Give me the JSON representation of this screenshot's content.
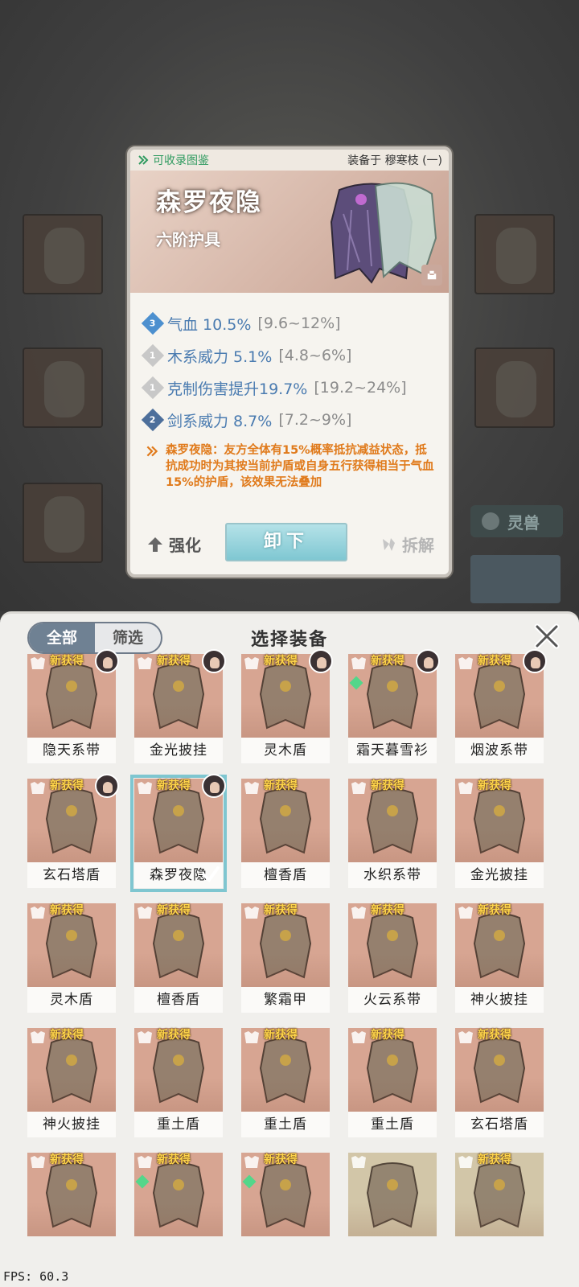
{
  "background": {
    "pet_label": "灵兽"
  },
  "detail": {
    "collectable": "可收录图鉴",
    "equipped_by": "装备于 穆寒枝 (一)",
    "name": "森罗夜隐",
    "grade": "六阶护具",
    "stats": [
      {
        "level": "3",
        "label": "气血 10.5%",
        "range": "[9.6~12%]",
        "badge": "blue"
      },
      {
        "level": "1",
        "label": "木系威力 5.1%",
        "range": "[4.8~6%]",
        "badge": "grey"
      },
      {
        "level": "1",
        "label": "克制伤害提升19.7%",
        "range": "[19.2~24%]",
        "badge": "grey"
      },
      {
        "level": "2",
        "label": "剑系威力 8.7%",
        "range": "[7.2~9%]",
        "badge": "dark"
      }
    ],
    "special": "森罗夜隐：友方全体有15%概率抵抗减益状态，抵抗成功时为其按当前护盾或自身五行获得相当于气血15%的护盾，该效果无法叠加",
    "actions": {
      "strengthen": "强化",
      "unequip": "卸下",
      "dismantle": "拆解"
    }
  },
  "panel": {
    "title": "选择装备",
    "tabs": {
      "all": "全部",
      "filter": "筛选"
    },
    "new_tag": "新获得",
    "items": [
      {
        "name": "隐天系带",
        "color": "#d7a592",
        "new": true,
        "portrait": true,
        "gem": false,
        "selected": false
      },
      {
        "name": "金光披挂",
        "color": "#d7a592",
        "new": true,
        "portrait": true,
        "gem": false,
        "selected": false
      },
      {
        "name": "灵木盾",
        "color": "#d7a592",
        "new": true,
        "portrait": true,
        "gem": false,
        "selected": false
      },
      {
        "name": "霜天暮雪衫",
        "color": "#d7a592",
        "new": true,
        "portrait": true,
        "gem": true,
        "selected": false
      },
      {
        "name": "烟波系带",
        "color": "#d7a592",
        "new": true,
        "portrait": true,
        "gem": false,
        "selected": false
      },
      {
        "name": "玄石塔盾",
        "color": "#d7a592",
        "new": true,
        "portrait": true,
        "gem": false,
        "selected": false
      },
      {
        "name": "森罗夜隐",
        "color": "#d7a592",
        "new": true,
        "portrait": true,
        "gem": false,
        "selected": true
      },
      {
        "name": "檀香盾",
        "color": "#d7a592",
        "new": true,
        "portrait": false,
        "gem": false,
        "selected": false
      },
      {
        "name": "水织系带",
        "color": "#d7a592",
        "new": true,
        "portrait": false,
        "gem": false,
        "selected": false
      },
      {
        "name": "金光披挂",
        "color": "#d7a592",
        "new": true,
        "portrait": false,
        "gem": false,
        "selected": false
      },
      {
        "name": "灵木盾",
        "color": "#d7a592",
        "new": true,
        "portrait": false,
        "gem": false,
        "selected": false
      },
      {
        "name": "檀香盾",
        "color": "#d7a592",
        "new": true,
        "portrait": false,
        "gem": false,
        "selected": false
      },
      {
        "name": "繁霜甲",
        "color": "#d7a592",
        "new": true,
        "portrait": false,
        "gem": false,
        "selected": false
      },
      {
        "name": "火云系带",
        "color": "#d7a592",
        "new": true,
        "portrait": false,
        "gem": false,
        "selected": false
      },
      {
        "name": "神火披挂",
        "color": "#d7a592",
        "new": true,
        "portrait": false,
        "gem": false,
        "selected": false
      },
      {
        "name": "神火披挂",
        "color": "#d7a592",
        "new": true,
        "portrait": false,
        "gem": false,
        "selected": false
      },
      {
        "name": "重土盾",
        "color": "#d7a592",
        "new": true,
        "portrait": false,
        "gem": false,
        "selected": false
      },
      {
        "name": "重土盾",
        "color": "#d7a592",
        "new": true,
        "portrait": false,
        "gem": false,
        "selected": false
      },
      {
        "name": "重土盾",
        "color": "#d7a592",
        "new": true,
        "portrait": false,
        "gem": false,
        "selected": false
      },
      {
        "name": "玄石塔盾",
        "color": "#d7a592",
        "new": true,
        "portrait": false,
        "gem": false,
        "selected": false
      },
      {
        "name": "",
        "color": "#d7a592",
        "new": true,
        "portrait": false,
        "gem": false,
        "selected": false
      },
      {
        "name": "",
        "color": "#d7a592",
        "new": true,
        "portrait": false,
        "gem": true,
        "selected": false
      },
      {
        "name": "",
        "color": "#d7a592",
        "new": true,
        "portrait": false,
        "gem": true,
        "selected": false
      },
      {
        "name": "",
        "color": "#d2c6a8",
        "new": false,
        "portrait": false,
        "gem": false,
        "selected": false
      },
      {
        "name": "",
        "color": "#d2c6a8",
        "new": true,
        "portrait": false,
        "gem": false,
        "selected": false
      }
    ]
  },
  "fps": "FPS: 60.3"
}
